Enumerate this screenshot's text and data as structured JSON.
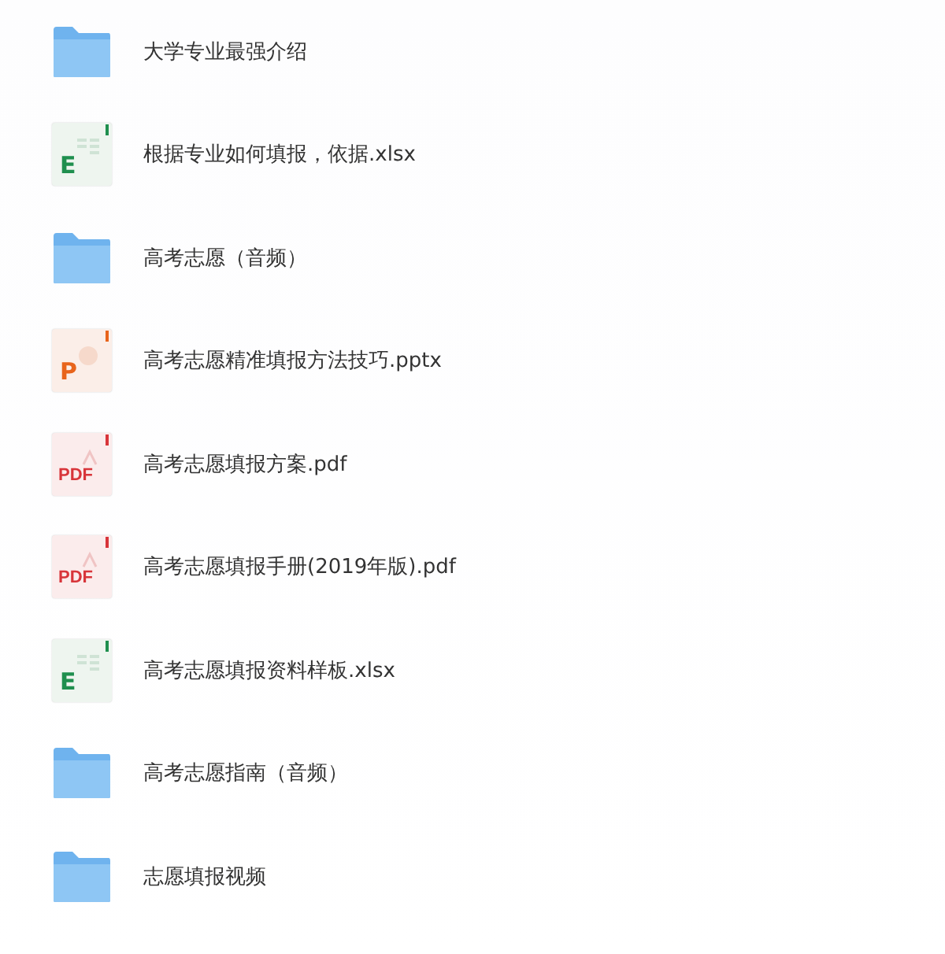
{
  "files": [
    {
      "kind": "folder",
      "name": "大学专业最强介绍"
    },
    {
      "kind": "xlsx",
      "icon_label": "E",
      "name": "根据专业如何填报，依据.xlsx"
    },
    {
      "kind": "folder",
      "name": "高考志愿（音频）"
    },
    {
      "kind": "pptx",
      "icon_label": "P",
      "name": "高考志愿精准填报方法技巧.pptx"
    },
    {
      "kind": "pdf",
      "icon_label": "PDF",
      "name": "高考志愿填报方案.pdf"
    },
    {
      "kind": "pdf",
      "icon_label": "PDF",
      "name": "高考志愿填报手册(2019年版).pdf"
    },
    {
      "kind": "xlsx",
      "icon_label": "E",
      "name": "高考志愿填报资料样板.xlsx"
    },
    {
      "kind": "folder",
      "name": "高考志愿指南（音频）"
    },
    {
      "kind": "folder",
      "name": "志愿填报视频"
    }
  ]
}
